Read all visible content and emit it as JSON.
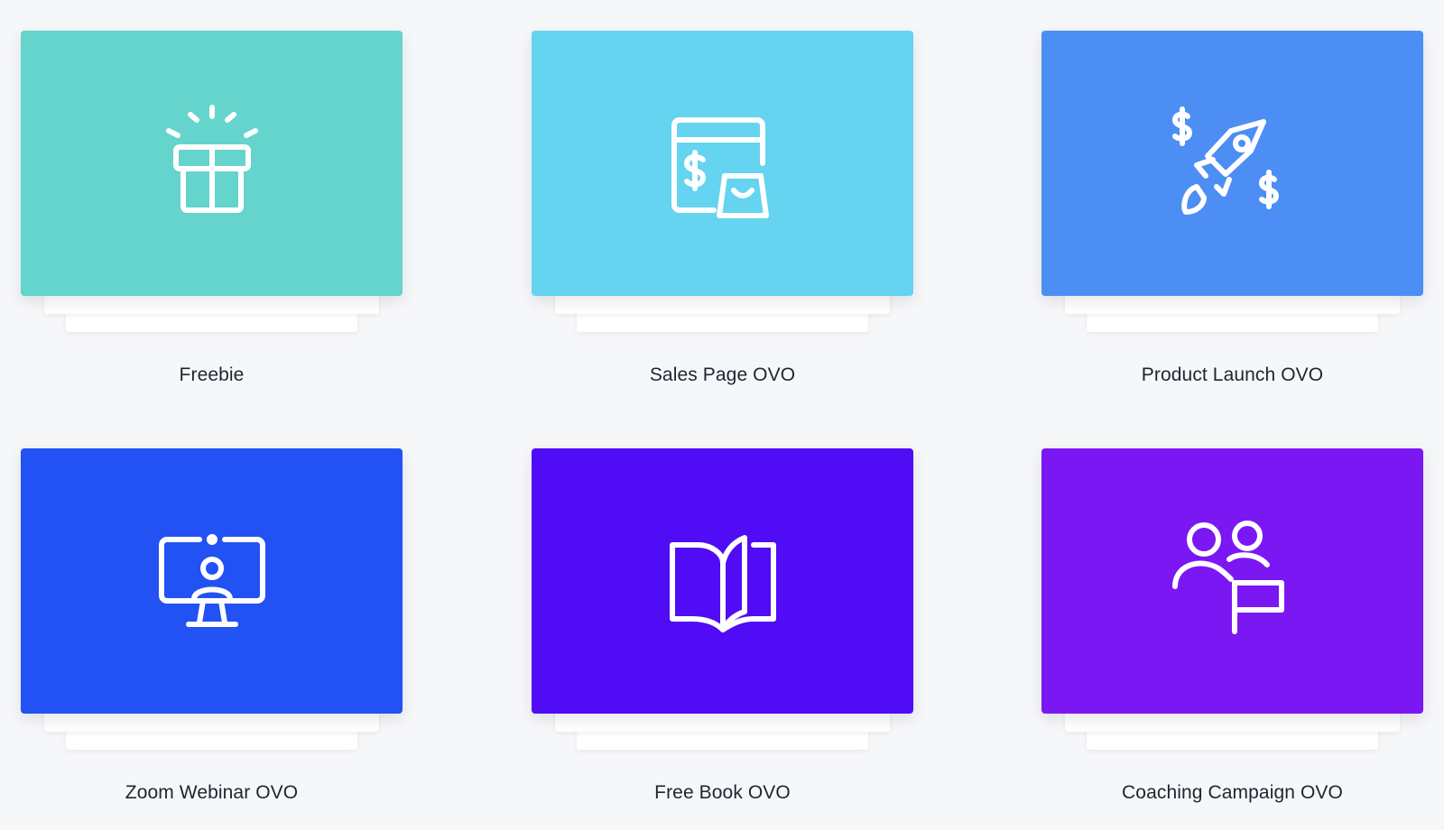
{
  "templates": [
    {
      "label": "Freebie",
      "color": "#64d4cc",
      "icon": "gift-icon"
    },
    {
      "label": "Sales Page OVO",
      "color": "#64d4f0",
      "icon": "shopping-page-icon"
    },
    {
      "label": "Product Launch OVO",
      "color": "#4c8ef4",
      "icon": "rocket-dollar-icon"
    },
    {
      "label": "Zoom Webinar OVO",
      "color": "#2252f4",
      "icon": "webinar-monitor-icon"
    },
    {
      "label": "Free Book OVO",
      "color": "#4f0cf5",
      "icon": "open-book-icon"
    },
    {
      "label": "Coaching Campaign OVO",
      "color": "#7b17f2",
      "icon": "group-flag-icon"
    }
  ]
}
